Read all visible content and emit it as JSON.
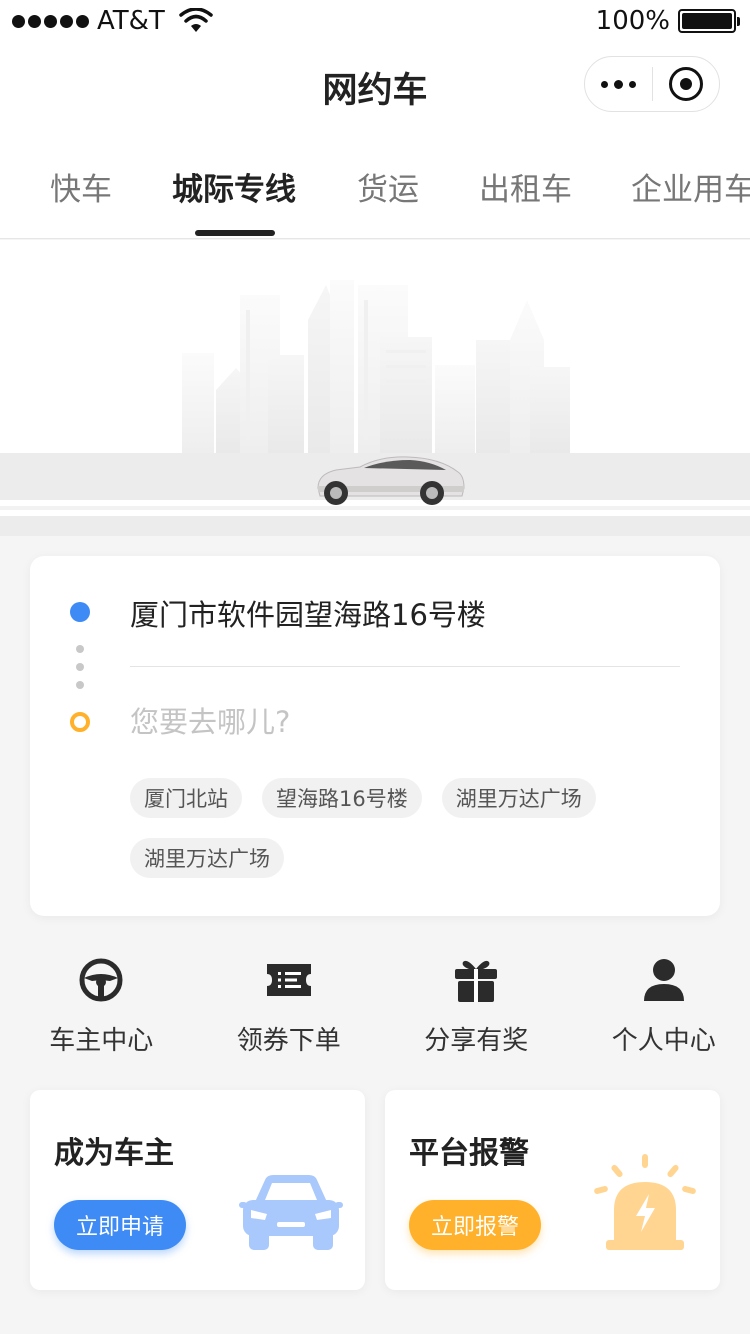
{
  "status_bar": {
    "carrier": "AT&T",
    "battery_percent": "100%",
    "icons": [
      "signal-dots-icon",
      "wifi-icon",
      "battery-icon"
    ]
  },
  "nav": {
    "title": "网约车",
    "capsule_icons": [
      "more-dots-icon",
      "close-target-icon"
    ]
  },
  "tabs": {
    "active_index": 1,
    "items": [
      {
        "label": "快车"
      },
      {
        "label": "城际专线"
      },
      {
        "label": "货运"
      },
      {
        "label": "出租车"
      },
      {
        "label": "企业用车"
      }
    ]
  },
  "route": {
    "from": "厦门市软件园望海路16号楼",
    "to_placeholder": "您要去哪儿?",
    "suggestions": [
      "厦门北站",
      "望海路16号楼",
      "湖里万达广场",
      "湖里万达广场"
    ]
  },
  "entries": [
    {
      "label": "车主中心",
      "icon": "steering-wheel-icon"
    },
    {
      "label": "领券下单",
      "icon": "ticket-icon"
    },
    {
      "label": "分享有奖",
      "icon": "gift-icon"
    },
    {
      "label": "个人中心",
      "icon": "person-icon"
    }
  ],
  "promos": {
    "driver": {
      "title": "成为车主",
      "button": "立即申请",
      "icon": "car-icon"
    },
    "alarm": {
      "title": "平台报警",
      "button": "立即报警",
      "icon": "alarm-light-icon"
    }
  },
  "colors": {
    "accent_blue": "#3e8bf5",
    "accent_orange": "#ffb12b",
    "car_icon_blue": "#a9c8fb",
    "alarm_icon_orange": "#ffd591"
  }
}
